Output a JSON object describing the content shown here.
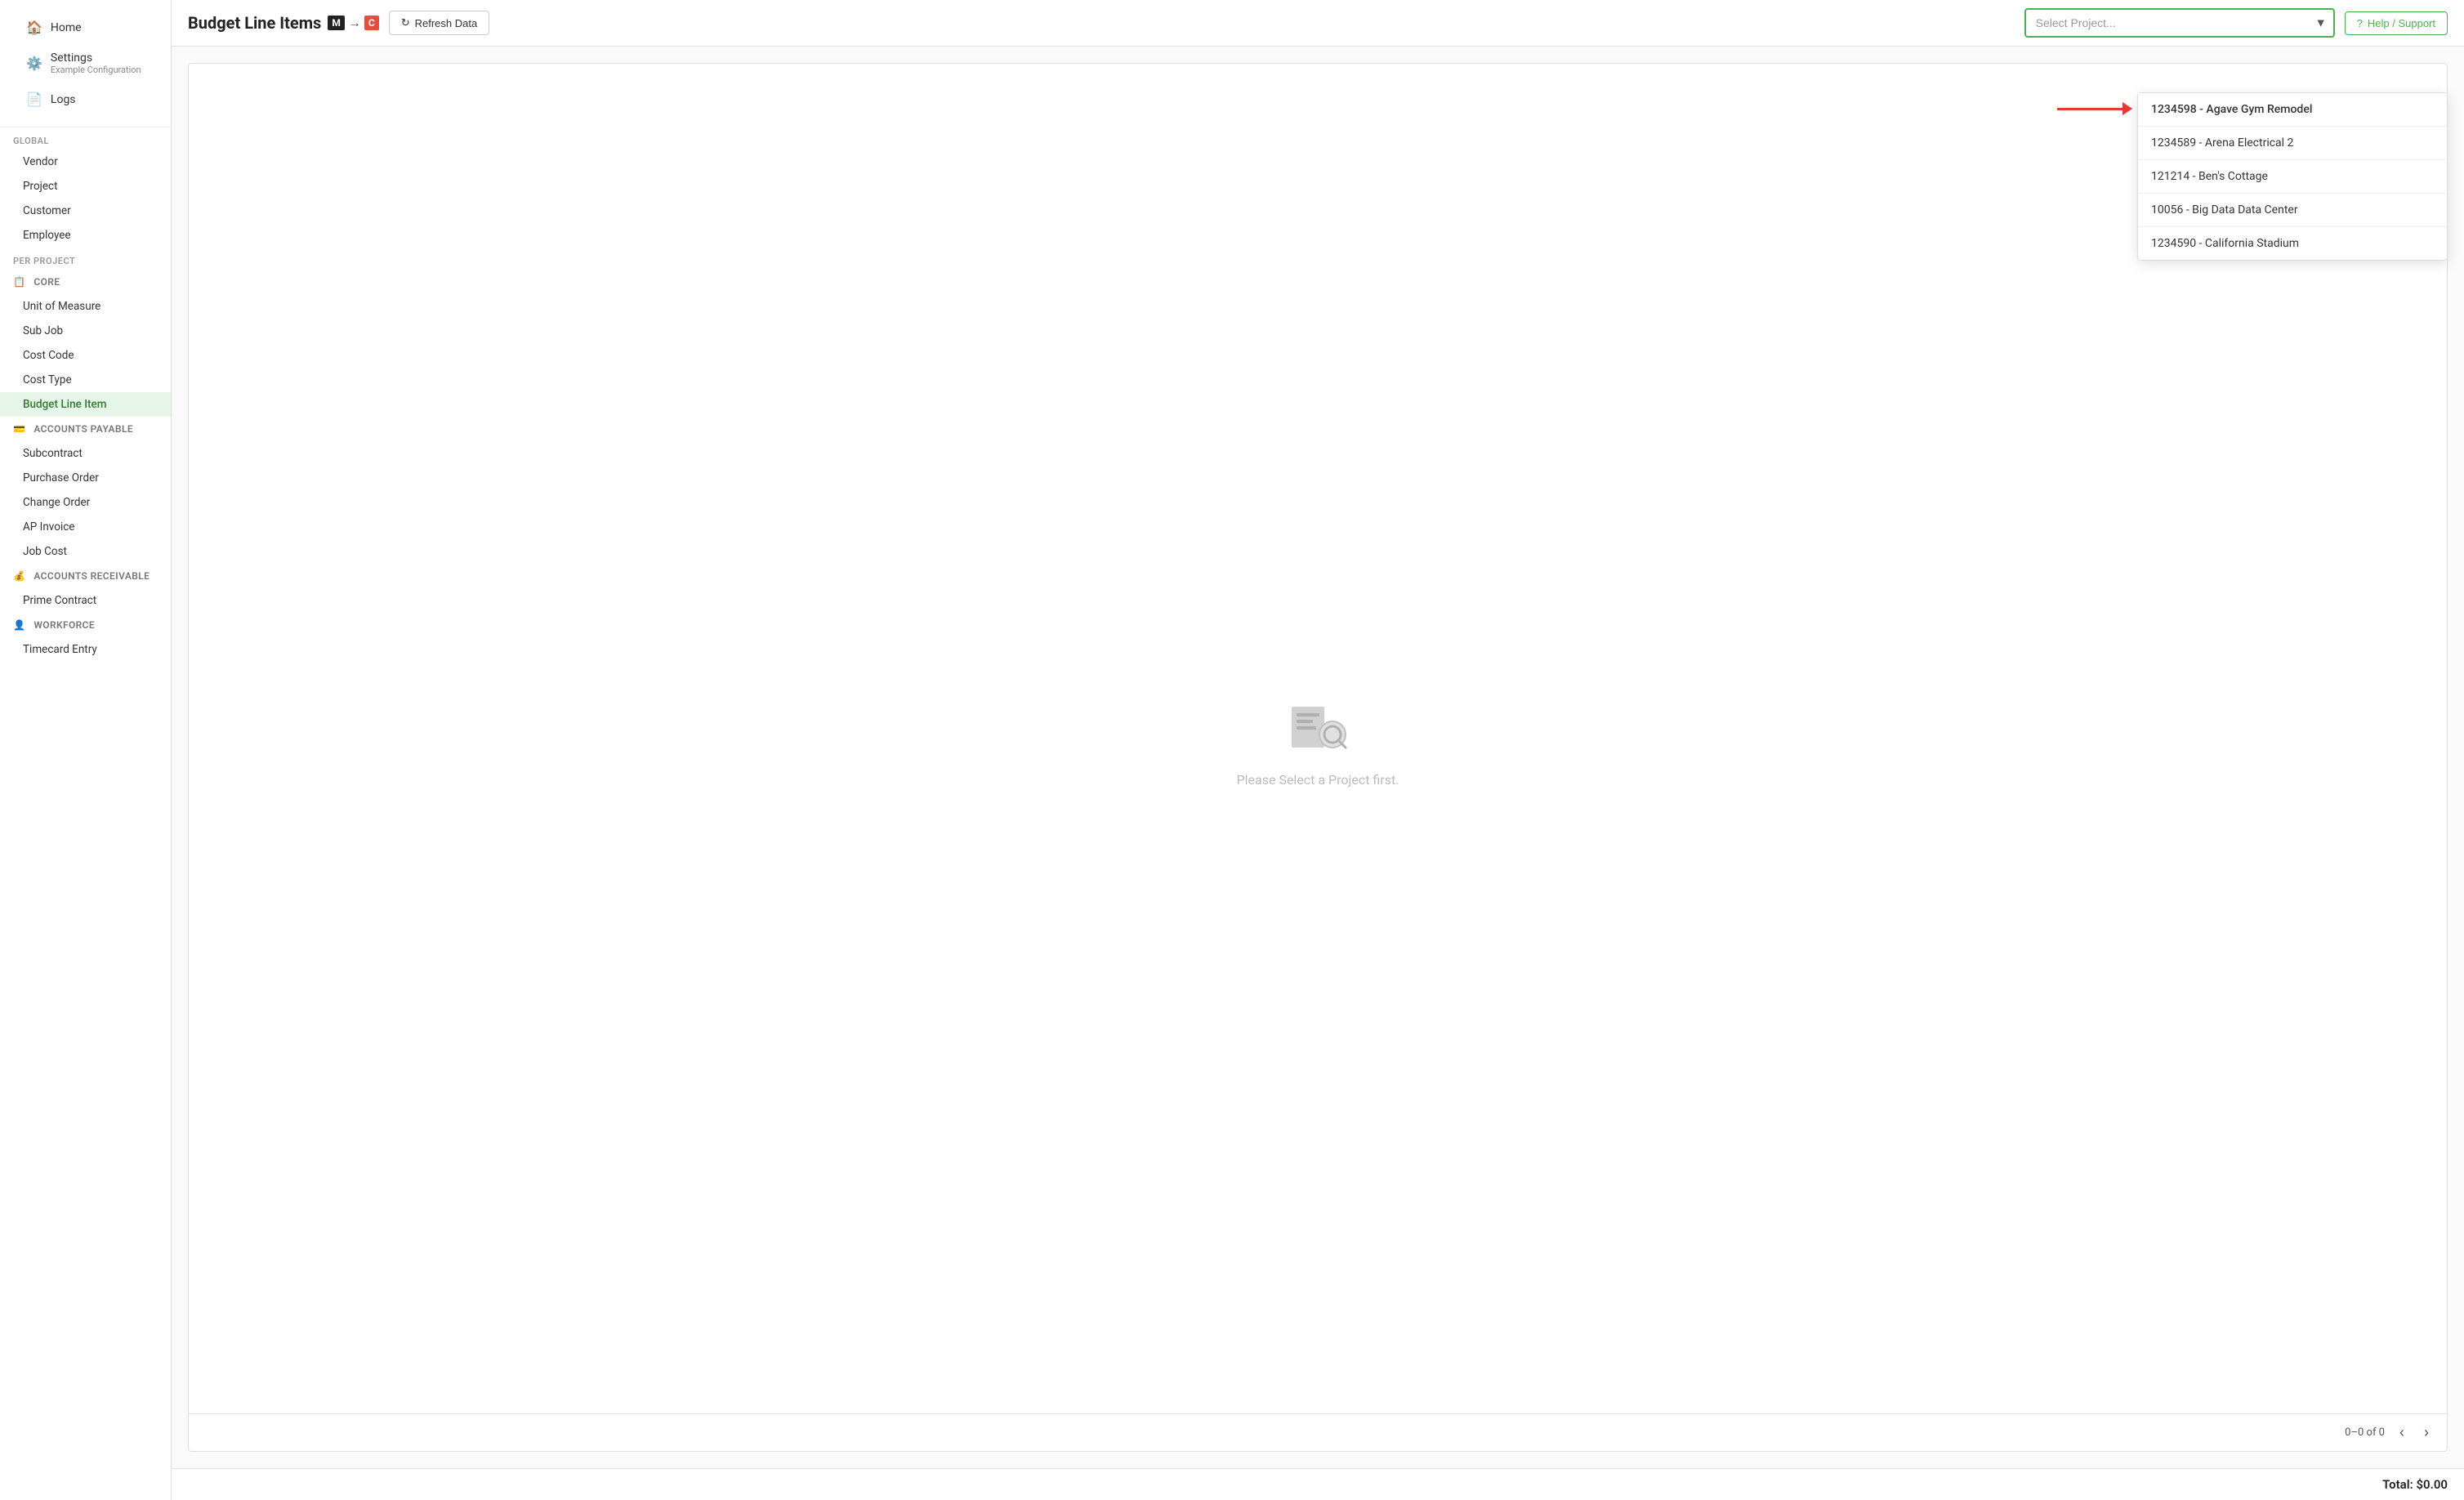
{
  "sidebar": {
    "nav_items": [
      {
        "id": "home",
        "label": "Home",
        "icon": "🏠"
      },
      {
        "id": "settings",
        "label": "Settings",
        "sub": "Example Configuration",
        "icon": "⚙️"
      },
      {
        "id": "logs",
        "label": "Logs",
        "icon": "📄"
      }
    ],
    "sections": [
      {
        "id": "global",
        "label": "GLOBAL",
        "links": [
          {
            "id": "vendor",
            "label": "Vendor"
          },
          {
            "id": "project",
            "label": "Project"
          },
          {
            "id": "customer",
            "label": "Customer"
          },
          {
            "id": "employee",
            "label": "Employee"
          }
        ]
      },
      {
        "id": "per-project",
        "label": "PER PROJECT",
        "groups": [
          {
            "id": "core",
            "label": "CORE",
            "icon": "📋",
            "links": [
              {
                "id": "unit-of-measure",
                "label": "Unit of Measure"
              },
              {
                "id": "sub-job",
                "label": "Sub Job"
              },
              {
                "id": "cost-code",
                "label": "Cost Code"
              },
              {
                "id": "cost-type",
                "label": "Cost Type"
              },
              {
                "id": "budget-line-item",
                "label": "Budget Line Item",
                "active": true
              }
            ]
          },
          {
            "id": "accounts-payable",
            "label": "ACCOUNTS PAYABLE",
            "icon": "💳",
            "links": [
              {
                "id": "subcontract",
                "label": "Subcontract"
              },
              {
                "id": "purchase-order",
                "label": "Purchase Order"
              },
              {
                "id": "change-order",
                "label": "Change Order"
              },
              {
                "id": "ap-invoice",
                "label": "AP Invoice"
              },
              {
                "id": "job-cost",
                "label": "Job Cost"
              }
            ]
          },
          {
            "id": "accounts-receivable",
            "label": "ACCOUNTS RECEIVABLE",
            "icon": "💰",
            "links": [
              {
                "id": "prime-contract",
                "label": "Prime Contract"
              }
            ]
          },
          {
            "id": "workforce",
            "label": "WORKFORCE",
            "icon": "👤",
            "links": [
              {
                "id": "timecard-entry",
                "label": "Timecard Entry"
              }
            ]
          }
        ]
      }
    ]
  },
  "topbar": {
    "page_title": "Budget Line Items",
    "integration_left_label": "M",
    "integration_right_label": "C",
    "refresh_btn_label": "Refresh Data",
    "select_project_placeholder": "Select Project...",
    "help_label": "Help / Support"
  },
  "dropdown": {
    "items": [
      {
        "id": "1234598",
        "label": "1234598 - Agave Gym Remodel",
        "highlighted": true
      },
      {
        "id": "1234589",
        "label": "1234589 - Arena Electrical 2"
      },
      {
        "id": "121214",
        "label": "121214 - Ben's Cottage"
      },
      {
        "id": "10056",
        "label": "10056 - Big Data Data Center"
      },
      {
        "id": "1234590",
        "label": "1234590 - California Stadium"
      }
    ]
  },
  "content": {
    "empty_state_text": "Please Select a Project first."
  },
  "footer": {
    "pagination_info": "0–0 of 0",
    "total_label": "Total: $0.00"
  }
}
